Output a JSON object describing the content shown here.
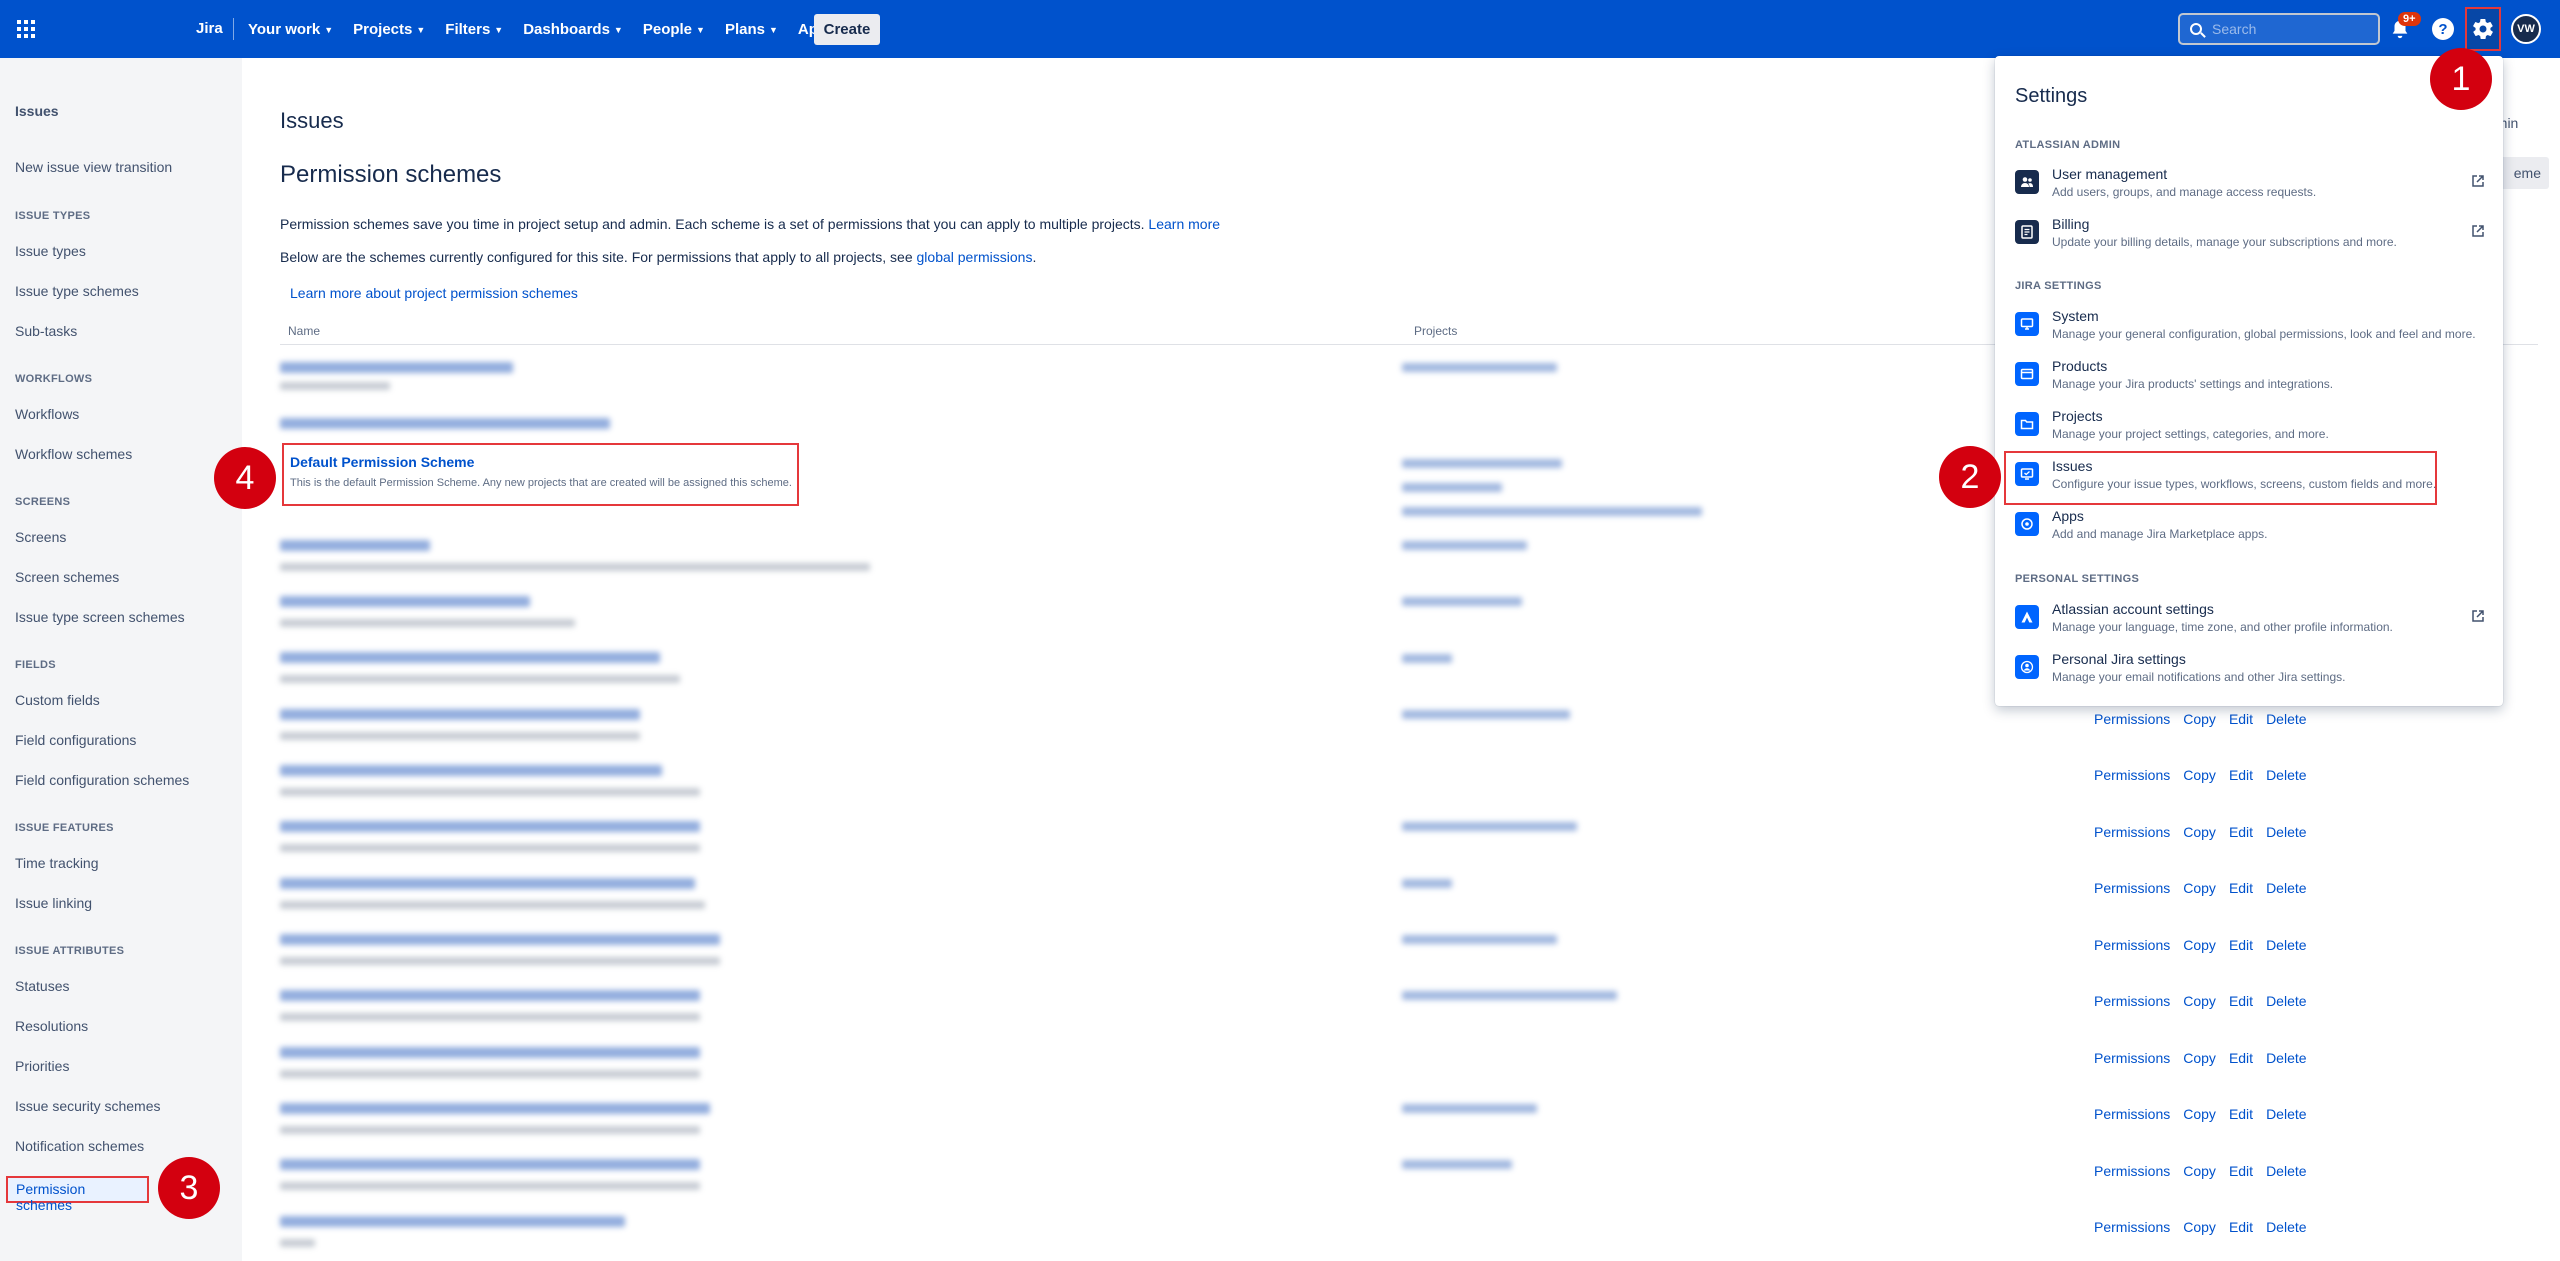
{
  "topnav": {
    "product": "Jira",
    "items": [
      {
        "label": "Your work"
      },
      {
        "label": "Projects"
      },
      {
        "label": "Filters"
      },
      {
        "label": "Dashboards"
      },
      {
        "label": "People"
      },
      {
        "label": "Plans"
      },
      {
        "label": "Apps"
      }
    ],
    "create_label": "Create",
    "search_placeholder": "Search",
    "notification_badge": "9+",
    "help_glyph": "?",
    "avatar_initials": "VW",
    "brand_color": "#0052cc"
  },
  "sidebar": {
    "title": "Issues",
    "top_items": [
      "New issue view transition"
    ],
    "sections": [
      {
        "heading": "ISSUE TYPES",
        "items": [
          "Issue types",
          "Issue type schemes",
          "Sub-tasks"
        ]
      },
      {
        "heading": "WORKFLOWS",
        "items": [
          "Workflows",
          "Workflow schemes"
        ]
      },
      {
        "heading": "SCREENS",
        "items": [
          "Screens",
          "Screen schemes",
          "Issue type screen schemes"
        ]
      },
      {
        "heading": "FIELDS",
        "items": [
          "Custom fields",
          "Field configurations",
          "Field configuration schemes"
        ]
      },
      {
        "heading": "ISSUE FEATURES",
        "items": [
          "Time tracking",
          "Issue linking"
        ]
      },
      {
        "heading": "ISSUE ATTRIBUTES",
        "items": [
          "Statuses",
          "Resolutions",
          "Priorities",
          "Issue security schemes",
          "Notification schemes"
        ]
      }
    ],
    "active_item": "Permission schemes"
  },
  "main": {
    "section_title": "Issues",
    "page_title": "Permission schemes",
    "intro_text": "Permission schemes save you time in project setup and admin. Each scheme is a set of permissions that you can apply to multiple projects.",
    "learn_more": "Learn more",
    "intro2_text": "Below are the schemes currently configured for this site. For permissions that apply to all projects, see",
    "global_permissions": "global permissions",
    "intro2_end": ".",
    "learn_more_project": "Learn more about project permission schemes",
    "col_name": "Name",
    "col_projects": "Projects",
    "default_scheme": {
      "name": "Default Permission Scheme",
      "description": "This is the default Permission Scheme. Any new projects that are created will be assigned this scheme."
    },
    "row_actions": {
      "permissions": "Permissions",
      "copy": "Copy",
      "edit": "Edit",
      "delete": "Delete"
    },
    "partial_admin_text": "dmin",
    "partial_button_text": "eme"
  },
  "settings": {
    "title": "Settings",
    "groups": [
      {
        "heading": "ATLASSIAN ADMIN",
        "items": [
          {
            "label": "User management",
            "desc": "Add users, groups, and manage access requests.",
            "icon": "users-icon",
            "external": true
          },
          {
            "label": "Billing",
            "desc": "Update your billing details, manage your subscriptions and more.",
            "icon": "billing-icon",
            "external": true
          }
        ]
      },
      {
        "heading": "JIRA SETTINGS",
        "items": [
          {
            "label": "System",
            "desc": "Manage your general configuration, global permissions, look and feel and more.",
            "icon": "system-icon",
            "external": false
          },
          {
            "label": "Products",
            "desc": "Manage your Jira products' settings and integrations.",
            "icon": "products-icon",
            "external": false
          },
          {
            "label": "Projects",
            "desc": "Manage your project settings, categories, and more.",
            "icon": "projects-icon",
            "external": false
          },
          {
            "label": "Issues",
            "desc": "Configure your issue types, workflows, screens, custom fields and more.",
            "icon": "issues-icon",
            "external": false
          },
          {
            "label": "Apps",
            "desc": "Add and manage Jira Marketplace apps.",
            "icon": "apps-icon",
            "external": false
          }
        ]
      },
      {
        "heading": "PERSONAL SETTINGS",
        "items": [
          {
            "label": "Atlassian account settings",
            "desc": "Manage your language, time zone, and other profile information.",
            "icon": "atlassian-icon",
            "external": true
          },
          {
            "label": "Personal Jira settings",
            "desc": "Manage your email notifications and other Jira settings.",
            "icon": "personal-icon",
            "external": false
          }
        ]
      }
    ]
  },
  "markers": [
    "1",
    "2",
    "3",
    "4"
  ],
  "highlight_color": "#e5383b",
  "marker_color": "#d3000f"
}
